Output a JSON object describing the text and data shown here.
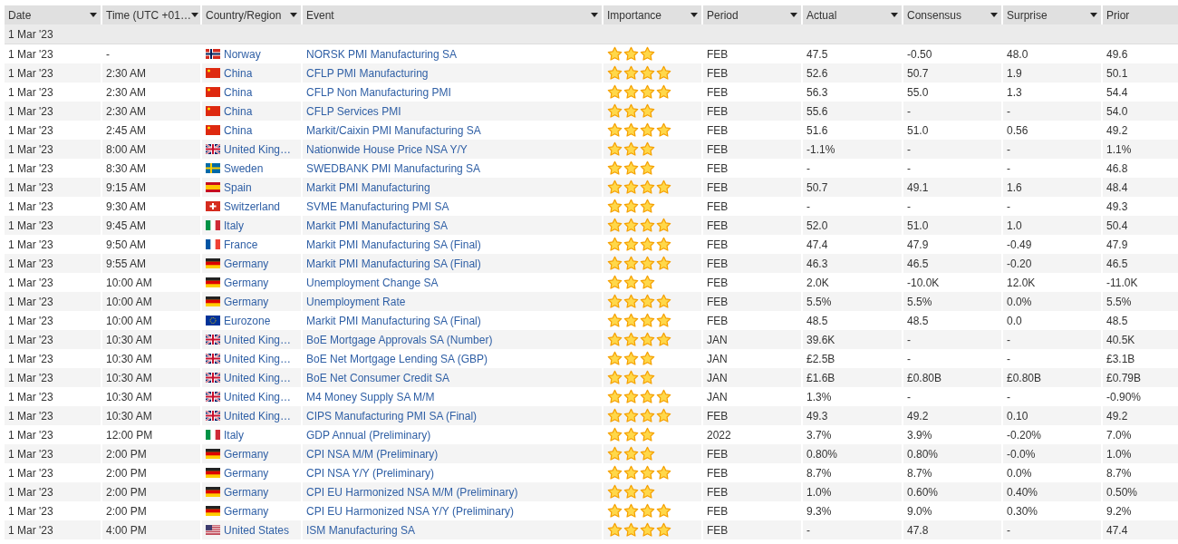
{
  "columns": [
    {
      "label": "Date"
    },
    {
      "label": "Time (UTC +01…"
    },
    {
      "label": "Country/Region"
    },
    {
      "label": "Event"
    },
    {
      "label": "Importance"
    },
    {
      "label": "Period"
    },
    {
      "label": "Actual"
    },
    {
      "label": "Consensus"
    },
    {
      "label": "Surprise"
    },
    {
      "label": "Prior"
    }
  ],
  "group": "1 Mar '23",
  "rows": [
    {
      "date": "1 Mar '23",
      "time": "-",
      "flag": {
        "kind": "no"
      },
      "country": "Norway",
      "event": "NORSK PMI Manufacturing SA",
      "stars": 3,
      "period": "FEB",
      "actual": "47.5",
      "consensus": "-0.50",
      "surprise": "48.0",
      "prior": "49.6"
    },
    {
      "date": "1 Mar '23",
      "time": "2:30 AM",
      "flag": {
        "kind": "cn"
      },
      "country": "China",
      "event": "CFLP PMI Manufacturing",
      "stars": 4,
      "period": "FEB",
      "actual": "52.6",
      "consensus": "50.7",
      "surprise": "1.9",
      "prior": "50.1"
    },
    {
      "date": "1 Mar '23",
      "time": "2:30 AM",
      "flag": {
        "kind": "cn"
      },
      "country": "China",
      "event": "CFLP Non Manufacturing PMI",
      "stars": 4,
      "period": "FEB",
      "actual": "56.3",
      "consensus": "55.0",
      "surprise": "1.3",
      "prior": "54.4"
    },
    {
      "date": "1 Mar '23",
      "time": "2:30 AM",
      "flag": {
        "kind": "cn"
      },
      "country": "China",
      "event": "CFLP Services PMI",
      "stars": 3,
      "period": "FEB",
      "actual": "55.6",
      "consensus": "-",
      "surprise": "-",
      "prior": "54.0"
    },
    {
      "date": "1 Mar '23",
      "time": "2:45 AM",
      "flag": {
        "kind": "cn"
      },
      "country": "China",
      "event": "Markit/Caixin PMI Manufacturing SA",
      "stars": 4,
      "period": "FEB",
      "actual": "51.6",
      "consensus": "51.0",
      "surprise": "0.56",
      "prior": "49.2"
    },
    {
      "date": "1 Mar '23",
      "time": "8:00 AM",
      "flag": {
        "kind": "gb"
      },
      "country": "United King…",
      "event": "Nationwide House Price NSA Y/Y",
      "stars": 3,
      "period": "FEB",
      "actual": "-1.1%",
      "consensus": "-",
      "surprise": "-",
      "prior": "1.1%"
    },
    {
      "date": "1 Mar '23",
      "time": "8:30 AM",
      "flag": {
        "kind": "se"
      },
      "country": "Sweden",
      "event": "SWEDBANK PMI Manufacturing SA",
      "stars": 3,
      "period": "FEB",
      "actual": "-",
      "consensus": "-",
      "surprise": "-",
      "prior": "46.8"
    },
    {
      "date": "1 Mar '23",
      "time": "9:15 AM",
      "flag": {
        "kind": "es"
      },
      "country": "Spain",
      "event": "Markit PMI Manufacturing",
      "stars": 4,
      "period": "FEB",
      "actual": "50.7",
      "consensus": "49.1",
      "surprise": "1.6",
      "prior": "48.4"
    },
    {
      "date": "1 Mar '23",
      "time": "9:30 AM",
      "flag": {
        "kind": "ch"
      },
      "country": "Switzerland",
      "event": "SVME Manufacturing PMI SA",
      "stars": 3,
      "period": "FEB",
      "actual": "-",
      "consensus": "-",
      "surprise": "-",
      "prior": "49.3"
    },
    {
      "date": "1 Mar '23",
      "time": "9:45 AM",
      "flag": {
        "kind": "it"
      },
      "country": "Italy",
      "event": "Markit PMI Manufacturing SA",
      "stars": 4,
      "period": "FEB",
      "actual": "52.0",
      "consensus": "51.0",
      "surprise": "1.0",
      "prior": "50.4"
    },
    {
      "date": "1 Mar '23",
      "time": "9:50 AM",
      "flag": {
        "kind": "fr"
      },
      "country": "France",
      "event": "Markit PMI Manufacturing SA (Final)",
      "stars": 4,
      "period": "FEB",
      "actual": "47.4",
      "consensus": "47.9",
      "surprise": "-0.49",
      "prior": "47.9"
    },
    {
      "date": "1 Mar '23",
      "time": "9:55 AM",
      "flag": {
        "kind": "de"
      },
      "country": "Germany",
      "event": "Markit PMI Manufacturing SA (Final)",
      "stars": 4,
      "period": "FEB",
      "actual": "46.3",
      "consensus": "46.5",
      "surprise": "-0.20",
      "prior": "46.5"
    },
    {
      "date": "1 Mar '23",
      "time": "10:00 AM",
      "flag": {
        "kind": "de"
      },
      "country": "Germany",
      "event": "Unemployment Change SA",
      "stars": 3,
      "period": "FEB",
      "actual": "2.0K",
      "consensus": "-10.0K",
      "surprise": "12.0K",
      "prior": "-11.0K"
    },
    {
      "date": "1 Mar '23",
      "time": "10:00 AM",
      "flag": {
        "kind": "de"
      },
      "country": "Germany",
      "event": "Unemployment Rate",
      "stars": 4,
      "period": "FEB",
      "actual": "5.5%",
      "consensus": "5.5%",
      "surprise": "0.0%",
      "prior": "5.5%"
    },
    {
      "date": "1 Mar '23",
      "time": "10:00 AM",
      "flag": {
        "kind": "eu"
      },
      "country": "Eurozone",
      "event": "Markit PMI Manufacturing SA (Final)",
      "stars": 4,
      "period": "FEB",
      "actual": "48.5",
      "consensus": "48.5",
      "surprise": "0.0",
      "prior": "48.5"
    },
    {
      "date": "1 Mar '23",
      "time": "10:30 AM",
      "flag": {
        "kind": "gb"
      },
      "country": "United King…",
      "event": "BoE Mortgage Approvals SA (Number)",
      "stars": 4,
      "period": "JAN",
      "actual": "39.6K",
      "consensus": "-",
      "surprise": "-",
      "prior": "40.5K"
    },
    {
      "date": "1 Mar '23",
      "time": "10:30 AM",
      "flag": {
        "kind": "gb"
      },
      "country": "United King…",
      "event": "BoE Net Mortgage Lending SA (GBP)",
      "stars": 3,
      "period": "JAN",
      "actual": "£2.5B",
      "consensus": "-",
      "surprise": "-",
      "prior": "£3.1B"
    },
    {
      "date": "1 Mar '23",
      "time": "10:30 AM",
      "flag": {
        "kind": "gb"
      },
      "country": "United King…",
      "event": "BoE Net Consumer Credit SA",
      "stars": 3,
      "period": "JAN",
      "actual": "£1.6B",
      "consensus": "£0.80B",
      "surprise": "£0.80B",
      "prior": "£0.79B"
    },
    {
      "date": "1 Mar '23",
      "time": "10:30 AM",
      "flag": {
        "kind": "gb"
      },
      "country": "United King…",
      "event": "M4 Money Supply SA M/M",
      "stars": 4,
      "period": "JAN",
      "actual": "1.3%",
      "consensus": "-",
      "surprise": "-",
      "prior": "-0.90%"
    },
    {
      "date": "1 Mar '23",
      "time": "10:30 AM",
      "flag": {
        "kind": "gb"
      },
      "country": "United King…",
      "event": "CIPS Manufacturing PMI SA (Final)",
      "stars": 4,
      "period": "FEB",
      "actual": "49.3",
      "consensus": "49.2",
      "surprise": "0.10",
      "prior": "49.2"
    },
    {
      "date": "1 Mar '23",
      "time": "12:00 PM",
      "flag": {
        "kind": "it"
      },
      "country": "Italy",
      "event": "GDP Annual (Preliminary)",
      "stars": 3,
      "period": "2022",
      "actual": "3.7%",
      "consensus": "3.9%",
      "surprise": "-0.20%",
      "prior": "7.0%"
    },
    {
      "date": "1 Mar '23",
      "time": "2:00 PM",
      "flag": {
        "kind": "de"
      },
      "country": "Germany",
      "event": "CPI NSA M/M (Preliminary)",
      "stars": 3,
      "period": "FEB",
      "actual": "0.80%",
      "consensus": "0.80%",
      "surprise": "-0.0%",
      "prior": "1.0%"
    },
    {
      "date": "1 Mar '23",
      "time": "2:00 PM",
      "flag": {
        "kind": "de"
      },
      "country": "Germany",
      "event": "CPI NSA Y/Y (Preliminary)",
      "stars": 4,
      "period": "FEB",
      "actual": "8.7%",
      "consensus": "8.7%",
      "surprise": "0.0%",
      "prior": "8.7%"
    },
    {
      "date": "1 Mar '23",
      "time": "2:00 PM",
      "flag": {
        "kind": "de"
      },
      "country": "Germany",
      "event": "CPI EU Harmonized NSA M/M (Preliminary)",
      "stars": 3,
      "period": "FEB",
      "actual": "1.0%",
      "consensus": "0.60%",
      "surprise": "0.40%",
      "prior": "0.50%"
    },
    {
      "date": "1 Mar '23",
      "time": "2:00 PM",
      "flag": {
        "kind": "de"
      },
      "country": "Germany",
      "event": "CPI EU Harmonized NSA Y/Y (Preliminary)",
      "stars": 4,
      "period": "FEB",
      "actual": "9.3%",
      "consensus": "9.0%",
      "surprise": "0.30%",
      "prior": "9.2%"
    },
    {
      "date": "1 Mar '23",
      "time": "4:00 PM",
      "flag": {
        "kind": "us"
      },
      "country": "United States",
      "event": "ISM Manufacturing SA",
      "stars": 4,
      "period": "FEB",
      "actual": "-",
      "consensus": "47.8",
      "surprise": "-",
      "prior": "47.4"
    }
  ]
}
